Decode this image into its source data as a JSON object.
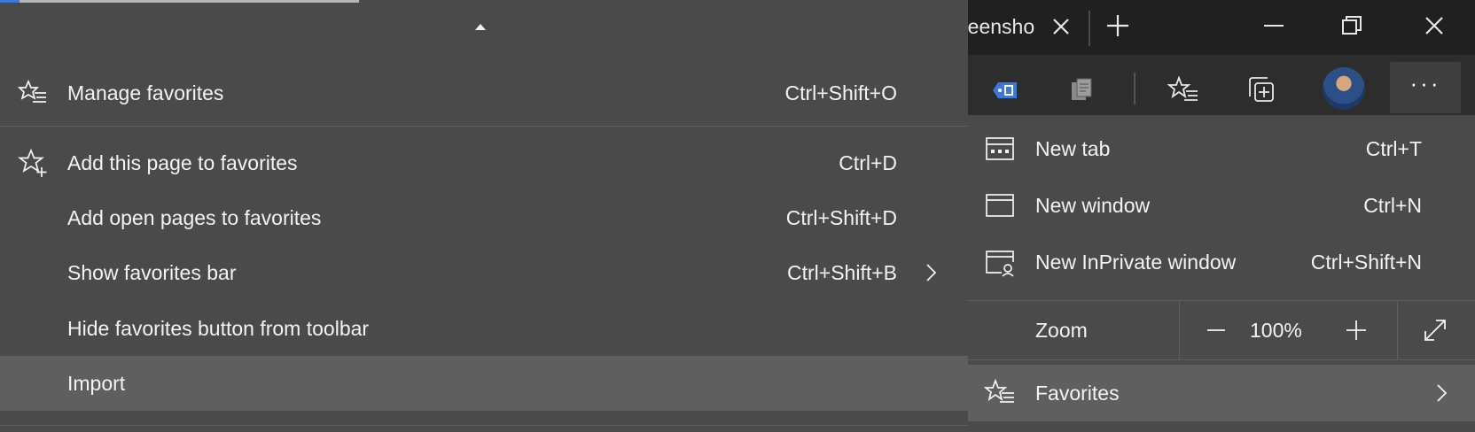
{
  "tab": {
    "title_fragment": "reensho"
  },
  "favorites_submenu": {
    "items": [
      {
        "label": "Manage favorites",
        "shortcut": "Ctrl+Shift+O",
        "icon": "favorites-list-icon"
      },
      {
        "label": "Add this page to favorites",
        "shortcut": "Ctrl+D",
        "icon": "star-add-icon"
      },
      {
        "label": "Add open pages to favorites",
        "shortcut": "Ctrl+Shift+D"
      },
      {
        "label": "Show favorites bar",
        "shortcut": "Ctrl+Shift+B",
        "has_submenu": true
      },
      {
        "label": "Hide favorites button from toolbar",
        "shortcut": ""
      },
      {
        "label": "Import",
        "shortcut": "",
        "highlighted": true
      }
    ]
  },
  "main_menu": {
    "items": [
      {
        "label": "New tab",
        "shortcut": "Ctrl+T",
        "icon": "new-tab-icon"
      },
      {
        "label": "New window",
        "shortcut": "Ctrl+N",
        "icon": "new-window-icon"
      },
      {
        "label": "New InPrivate window",
        "shortcut": "Ctrl+Shift+N",
        "icon": "inprivate-window-icon"
      }
    ],
    "zoom": {
      "label": "Zoom",
      "value": "100%"
    },
    "favorites": {
      "label": "Favorites",
      "highlighted": true,
      "icon": "favorites-list-icon"
    }
  },
  "toolbar_icons": [
    "extension-icon",
    "collections-copy-icon",
    "favorites-list-icon",
    "collections-add-icon",
    "avatar",
    "more-icon"
  ],
  "colors": {
    "menu_bg": "#4a4a4a",
    "highlight_bg": "#5f5f5f",
    "toolbar_bg": "#2d2d2d",
    "titlebar_bg": "#202020",
    "text": "#f3f3f3",
    "accent": "#3b78d8"
  }
}
